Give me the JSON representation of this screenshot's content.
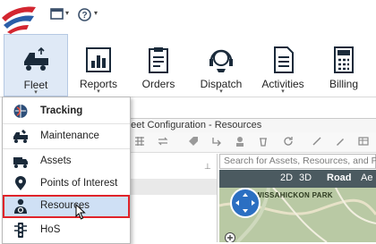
{
  "ribbon": {
    "fleet_label": "Fleet",
    "reports_label": "Reports",
    "orders_label": "Orders",
    "dispatch_label": "Dispatch",
    "activities_label": "Activities",
    "billing_label": "Billing",
    "dropdown_caret": "▾"
  },
  "quick_access": {
    "caret": "▾"
  },
  "fleet_menu": {
    "items": [
      {
        "label": "Tracking",
        "icon": "globe-icon"
      },
      {
        "label": "Maintenance",
        "icon": "maintenance-truck-icon"
      },
      {
        "label": "Assets",
        "icon": "truck-icon"
      },
      {
        "label": "Points of Interest",
        "icon": "map-pin-icon"
      },
      {
        "label": "Resources",
        "icon": "driver-icon"
      },
      {
        "label": "HoS",
        "icon": "traffic-light-icon"
      }
    ],
    "selected": "Resources",
    "highlight_color": "#e0242a"
  },
  "content": {
    "tab_title": "Fleet Configuration - Resources",
    "search_placeholder": "Search for Assets, Resources, and POIs",
    "pin_glyph": "⊥"
  },
  "map": {
    "tab_2d": "2D",
    "tab_3d": "3D",
    "tab_road": "Road",
    "tab_ae": "Ae",
    "place_label": "WISSAHICKON PARK"
  },
  "colors": {
    "accent": "#1f5fa8",
    "ribbon_icon": "#1a2a3a"
  }
}
